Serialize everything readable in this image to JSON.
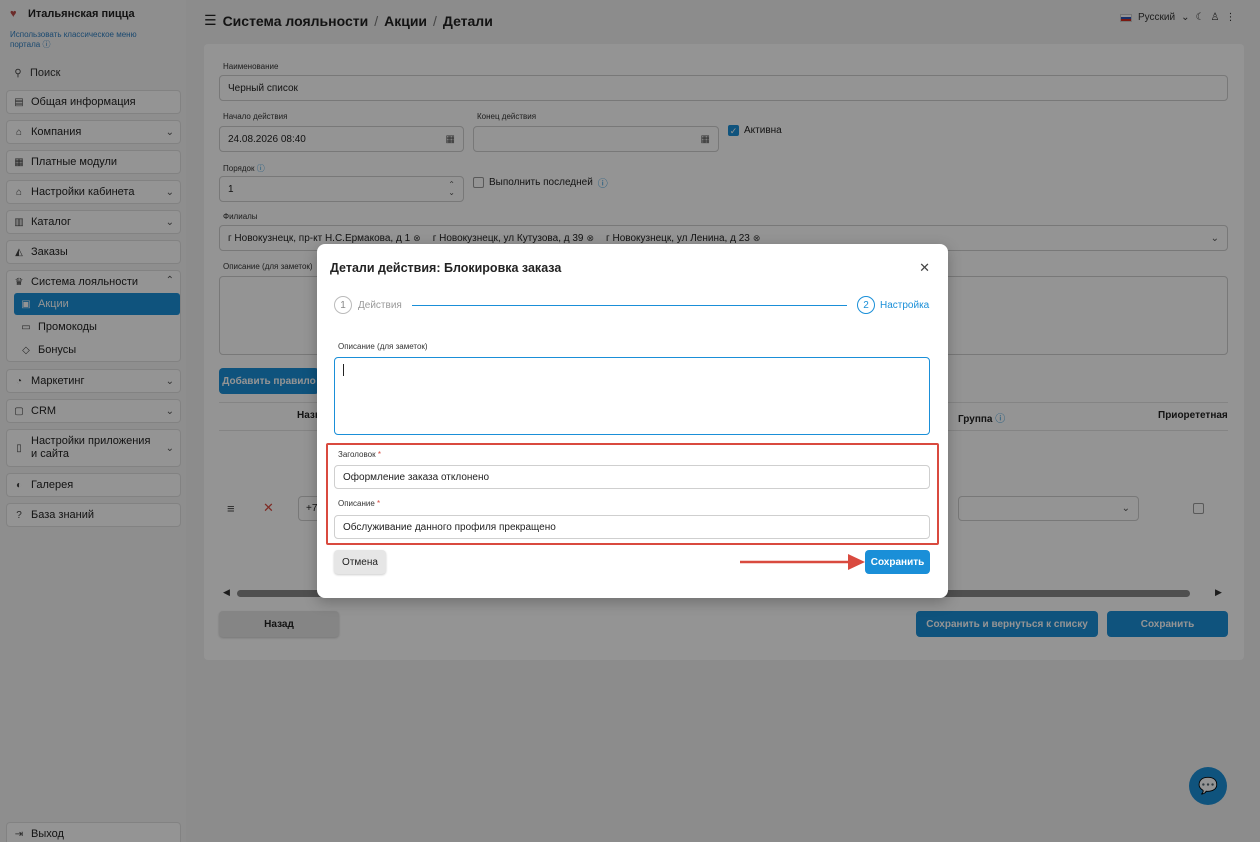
{
  "sidebar": {
    "brand": "Итальянская пицца",
    "classic_link": "Использовать классическое меню портала",
    "search": "Поиск",
    "items": [
      {
        "label": "Общая информация"
      },
      {
        "label": "Компания"
      },
      {
        "label": "Платные модули"
      },
      {
        "label": "Настройки кабинета"
      },
      {
        "label": "Каталог"
      },
      {
        "label": "Заказы"
      },
      {
        "label": "Система лояльности"
      },
      {
        "label": "Маркетинг"
      },
      {
        "label": "CRM"
      },
      {
        "label": "Настройки приложения и сайта"
      },
      {
        "label": "Галерея"
      },
      {
        "label": "База знаний"
      }
    ],
    "loyalty_sub": [
      {
        "label": "Акции"
      },
      {
        "label": "Промокоды"
      },
      {
        "label": "Бонусы"
      }
    ],
    "logout": "Выход"
  },
  "header": {
    "crumbs": [
      "Система лояльности",
      "Акции",
      "Детали"
    ],
    "language": "Русский"
  },
  "form": {
    "name_label": "Наименование",
    "name_value": "Черный список",
    "start_label": "Начало действия",
    "start_value": "24.08.2026 08:40",
    "end_label": "Конец действия",
    "active_label": "Активна",
    "order_label": "Порядок",
    "order_value": "1",
    "last_label": "Выполнить последней",
    "branches_label": "Филиалы",
    "branches": [
      "г Новокузнецк, пр-кт Н.С.Ермакова, д 1",
      "г Новокузнецк, ул Кутузова, д 39",
      "г Новокузнецк, ул Ленина, д 23"
    ],
    "desc_label": "Описание (для заметок)",
    "add_rule": "Добавить правило",
    "col_name": "Назв",
    "col_group": "Группа",
    "col_priority": "Приорететная",
    "phone_partial": "+7",
    "back": "Назад",
    "save_return": "Сохранить и вернуться к списку",
    "save": "Сохранить"
  },
  "modal": {
    "title": "Детали действия: Блокировка заказа",
    "step1_num": "1",
    "step1": "Действия",
    "step2_num": "2",
    "step2": "Настройка",
    "desc_label": "Описание (для заметок)",
    "desc_value": "",
    "heading_label": "Заголовок",
    "heading_value": "Оформление заказа отклонено",
    "description_label": "Описание",
    "description_value": "Обслуживание данного профиля прекращено",
    "required_mark": "*",
    "cancel": "Отмена",
    "save": "Сохранить"
  },
  "colors": {
    "accent": "#1a8fd8",
    "annotation": "#d94a3f"
  }
}
